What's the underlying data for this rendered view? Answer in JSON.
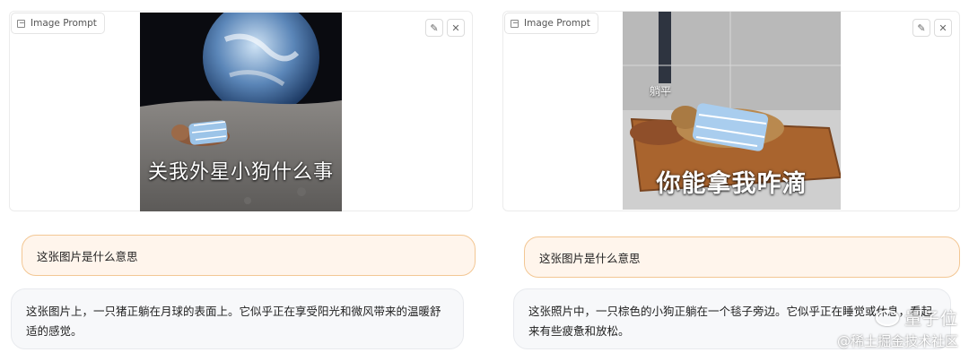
{
  "left": {
    "image_label": "Image Prompt",
    "image_caption": "关我外星小狗什么事",
    "question": "这张图片是什么意思",
    "answer": "这张图片上，一只猪正躺在月球的表面上。它似乎正在享受阳光和微风带来的温暖舒适的感觉。"
  },
  "right": {
    "image_label": "Image Prompt",
    "image_tag": "躺平",
    "image_caption": "你能拿我咋滴",
    "question": "这张图片是什么意思",
    "answer": "这张照片中，一只棕色的小狗正躺在一个毯子旁边。它似乎正在睡觉或休息，看起来有些疲惫和放松。"
  },
  "watermark": {
    "line1": "量子位",
    "line2": "@稀土掘金技术社区"
  },
  "colors": {
    "question_bg": "#fff5ec",
    "question_border": "#f3c794",
    "answer_bg": "#f7f8fa"
  },
  "icons": {
    "label": "image-icon",
    "edit": "pencil-icon",
    "close": "close-icon"
  }
}
